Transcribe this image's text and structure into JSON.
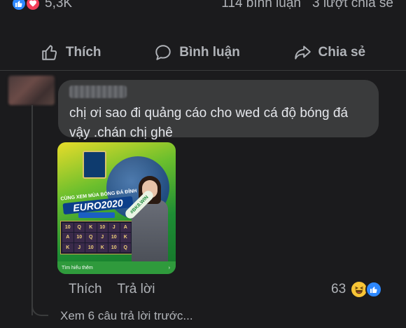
{
  "stats": {
    "reaction_count": "5,3K",
    "comments": "114 bình luận",
    "shares": "3 lượt chia sẻ"
  },
  "actions": {
    "like": "Thích",
    "comment": "Bình luận",
    "share": "Chia sẻ"
  },
  "comment": {
    "text_line1": "chị ơi sao đi quảng cáo cho wed cá độ bóng đá",
    "text_line2": "vậy .chán chị ghê",
    "like_label": "Thích",
    "reply_label": "Trả lời",
    "reaction_count": "63"
  },
  "ad": {
    "title": "CÙNG XEM MÙA BÓNG ĐÁ ĐỈNH",
    "euro": "EURO2020",
    "tag": "#BK8.WIN",
    "footer": "Tìm hiểu thêm",
    "footer_arrow": "›",
    "slots": [
      "10",
      "Q",
      "K",
      "10",
      "J",
      "A",
      "A",
      "10",
      "Q",
      "J",
      "10",
      "K",
      "K",
      "J",
      "10",
      "K",
      "10",
      "Q"
    ]
  },
  "replies": {
    "view_more": "Xem 6 câu trả lời trước..."
  },
  "colors": {
    "background": "#1b1b1d",
    "bubble": "#3a3b3c",
    "like_blue": "#2d88ff",
    "love_red": "#f33e58",
    "text_secondary": "#b0b3b8"
  }
}
